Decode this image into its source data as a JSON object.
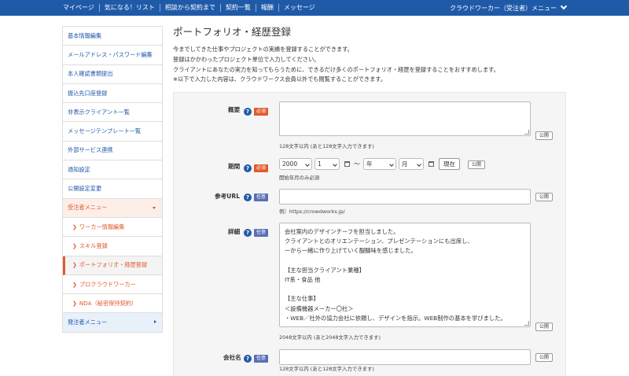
{
  "nav": {
    "links": [
      "マイページ",
      "気になる！リスト",
      "相談から契約まで",
      "契約一覧",
      "報酬",
      "メッセージ"
    ],
    "user_menu": "クラウドワーカー（受注者）メニュー"
  },
  "sidebar": {
    "items": [
      {
        "label": "基本情報編集",
        "kind": "item"
      },
      {
        "label": "メールアドレス・パスワード編集",
        "kind": "item"
      },
      {
        "label": "本人確認書類提出",
        "kind": "item"
      },
      {
        "label": "振込先口座登録",
        "kind": "item"
      },
      {
        "label": "非表示クライアント一覧",
        "kind": "item"
      },
      {
        "label": "メッセージテンプレート一覧",
        "kind": "item"
      },
      {
        "label": "外部サービス連携",
        "kind": "item"
      },
      {
        "label": "通知設定",
        "kind": "item"
      },
      {
        "label": "公開設定変更",
        "kind": "item"
      },
      {
        "label": "受注者メニュー",
        "kind": "section"
      },
      {
        "label": "ワーカー情報編集",
        "kind": "sub"
      },
      {
        "label": "スキル登録",
        "kind": "sub"
      },
      {
        "label": "ポートフォリオ・経歴登録",
        "kind": "sub-active"
      },
      {
        "label": "プロクラウドワーカー",
        "kind": "sub"
      },
      {
        "label": "NDA（秘密保持契約）",
        "kind": "sub"
      },
      {
        "label": "発注者メニュー",
        "kind": "section2"
      }
    ],
    "sub_arrow": "❯"
  },
  "main": {
    "title": "ポートフォリオ・経歴登録",
    "intro": [
      "今までしてきた仕事やプロジェクトの実績を登録することができます。",
      "登録はかかわったプロジェクト単位で入力してください。",
      "クライアントにあなたの実力を知ってもらうために、できるだけ多くのポートフォリオ・経歴を登録することをおすすめします。",
      "※以下で入力した内容は、クラウドワークス会員以外でも閲覧することができます。"
    ]
  },
  "form": {
    "help_glyph": "?",
    "required_label": "必須",
    "optional_label": "任意",
    "public_label": "公開",
    "summary": {
      "label": "概要",
      "hint": "128文字以内 (あと128文字入力できます)"
    },
    "period": {
      "label": "期間",
      "start_year": "2000",
      "start_month": "1",
      "tilde": "〜",
      "end_year": "年",
      "end_month": "月",
      "now_button": "現在",
      "hint": "開始年月のみ必須"
    },
    "url": {
      "label": "参考URL",
      "hint": "例）https://crowdworks.jp/"
    },
    "detail": {
      "label": "詳細",
      "text": "会社案内のデザインチーフを担当しました。\nクライアントとのオリエンテーション、プレゼンテーションにも出席し、\n一から一緒に作り上げていく醍醐味を感じました。\n\n【主な担当クライアント業種】\nIT系・食品 他\n\n【主な仕事】\n＜設備機器メーカー〇社＞\n・WEB／社外の協力会社に依頼し、デザインを指示。WEB制作の基本を学びました。",
      "hint": "2048文字以内 (あと2048文字入力できます)"
    },
    "company": {
      "label": "会社名",
      "hint": "128文字以内 (あと128文字入力できます)"
    }
  },
  "colors": {
    "nav_bg": "#1f5aa8",
    "accent": "#e25a2c",
    "link": "#1f5aa8"
  }
}
